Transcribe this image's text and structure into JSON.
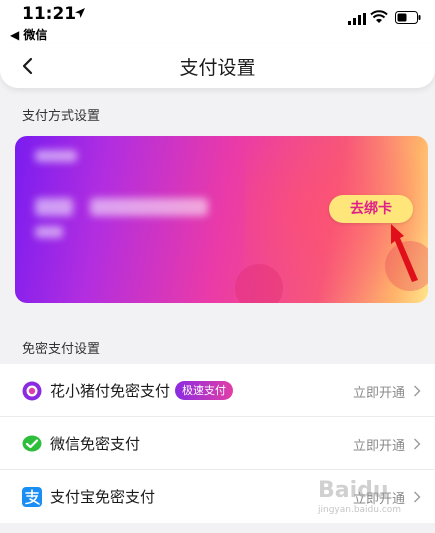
{
  "status_bar": {
    "time": "11:21",
    "back_app": "◀ 微信"
  },
  "nav": {
    "title": "支付设置"
  },
  "payment_section": {
    "label": "支付方式设置",
    "unbind_label": "去绑卡"
  },
  "nopass_section": {
    "label": "免密支付设置",
    "items": [
      {
        "label": "花小猪付免密支付",
        "badge": "极速支付",
        "action": "立即开通",
        "icon": "piggy-pay-icon"
      },
      {
        "label": "微信免密支付",
        "action": "立即开通",
        "icon": "wechat-icon"
      },
      {
        "label": "支付宝免密支付",
        "action": "立即开通",
        "icon": "alipay-icon"
      }
    ]
  },
  "colors": {
    "accent_pink": "#e0208a",
    "button_yellow": "#ffe67a",
    "wechat_green": "#2dbe3c",
    "alipay_blue": "#1a8ef5"
  },
  "watermark": {
    "text": "Baidu",
    "sub": "jingyan.baidu.com"
  }
}
